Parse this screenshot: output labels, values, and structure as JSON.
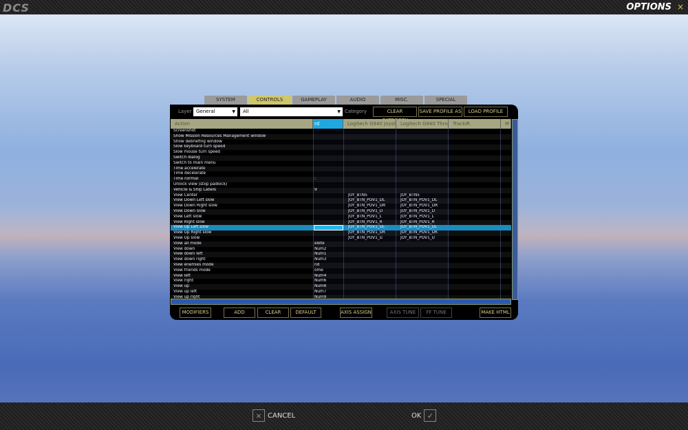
{
  "header": {
    "logo": "DCS",
    "title": "OPTIONS",
    "close": "×"
  },
  "tabs": [
    "SYSTEM",
    "CONTROLS",
    "GAMEPLAY",
    "AUDIO",
    "MISC.",
    "SPECIAL"
  ],
  "active_tab": "CONTROLS",
  "toolbar": {
    "layer_label": "Layer",
    "layer_value": "General",
    "category_filter_value": "All",
    "category_label": "Category",
    "clear_category": "CLEAR CATEGORY",
    "save_profile_as": "SAVE PROFILE AS",
    "load_profile": "LOAD PROFILE"
  },
  "columns": [
    "Action",
    "rd",
    "Logitech G940 Joyst",
    "Logitech G940 Throt",
    "TrackIR",
    "M"
  ],
  "rows": [
    {
      "action": "Screenshot",
      "kb": "",
      "joy": "",
      "thr": ""
    },
    {
      "action": "Show Mission Resources Management window",
      "kb": "",
      "joy": "",
      "thr": ""
    },
    {
      "action": "Show debriefing window",
      "kb": "",
      "joy": "",
      "thr": ""
    },
    {
      "action": "Slow keyboard turn speed",
      "kb": "",
      "joy": "",
      "thr": ""
    },
    {
      "action": "Slow mouse turn speed",
      "kb": "",
      "joy": "",
      "thr": ""
    },
    {
      "action": "Switch dialog",
      "kb": "",
      "joy": "",
      "thr": ""
    },
    {
      "action": "Switch to main menu",
      "kb": "",
      "joy": "",
      "thr": ""
    },
    {
      "action": "Time accelerate",
      "kb": "",
      "joy": "",
      "thr": ""
    },
    {
      "action": "Time decelerate",
      "kb": "",
      "joy": "",
      "thr": ""
    },
    {
      "action": "Time normal",
      "kb": ":",
      "joy": "",
      "thr": ""
    },
    {
      "action": "Unlock view (stop padlock)",
      "kb": "",
      "joy": "",
      "thr": ""
    },
    {
      "action": "Vehicle & Ship Labels",
      "kb": "9",
      "joy": "",
      "thr": ""
    },
    {
      "action": "View Center",
      "kb": "",
      "joy": "JOY_BTN5",
      "thr": "JOY_BTN5"
    },
    {
      "action": "View Down Left slow",
      "kb": "",
      "joy": "JOY_BTN_POV1_DL",
      "thr": "JOY_BTN_POV1_DL"
    },
    {
      "action": "View Down Right slow",
      "kb": "",
      "joy": "JOY_BTN_POV1_DR",
      "thr": "JOY_BTN_POV1_DR"
    },
    {
      "action": "View Down slow",
      "kb": "",
      "joy": "JOY_BTN_POV1_D",
      "thr": "JOY_BTN_POV1_D"
    },
    {
      "action": "View Left slow",
      "kb": "",
      "joy": "JOY_BTN_POV1_L",
      "thr": "JOY_BTN_POV1_L"
    },
    {
      "action": "View Right slow",
      "kb": "",
      "joy": "JOY_BTN_POV1_R",
      "thr": "JOY_BTN_POV1_R"
    },
    {
      "action": "View Up Left slow",
      "kb": "",
      "joy": "JOY_BTN_POV1_UL",
      "thr": "JOY_BTN_POV1_UL",
      "selected": true
    },
    {
      "action": "View Up Right slow",
      "kb": "",
      "joy": "JOY_BTN_POV1_UR",
      "thr": "JOY_BTN_POV1_UR"
    },
    {
      "action": "View Up slow",
      "kb": "",
      "joy": "JOY_BTN_POV1_U",
      "thr": "JOY_BTN_POV1_U"
    },
    {
      "action": "View all mode",
      "kb": "elete",
      "joy": "",
      "thr": ""
    },
    {
      "action": "View down",
      "kb": "Num2",
      "joy": "",
      "thr": ""
    },
    {
      "action": "View down left",
      "kb": "Num1",
      "joy": "",
      "thr": ""
    },
    {
      "action": "View down right",
      "kb": "Num3",
      "joy": "",
      "thr": ""
    },
    {
      "action": "View enemies mode",
      "kb": "nd",
      "joy": "",
      "thr": ""
    },
    {
      "action": "View friends mode",
      "kb": "ome",
      "joy": "",
      "thr": ""
    },
    {
      "action": "View left",
      "kb": "Num4",
      "joy": "",
      "thr": ""
    },
    {
      "action": "View right",
      "kb": "Num6",
      "joy": "",
      "thr": ""
    },
    {
      "action": "View up",
      "kb": "Num8",
      "joy": "",
      "thr": ""
    },
    {
      "action": "View up left",
      "kb": "Num7",
      "joy": "",
      "thr": ""
    },
    {
      "action": "View up right",
      "kb": "Num9",
      "joy": "",
      "thr": ""
    }
  ],
  "buttons": {
    "modifiers": "MODIFIERS",
    "add": "ADD",
    "clear": "CLEAR",
    "default": "DEFAULT",
    "axis_assign": "AXIS ASSIGN",
    "axis_tune": "AXIS TUNE",
    "ff_tune": "FF TUNE",
    "make_html": "MAKE HTML"
  },
  "footer": {
    "cancel": "CANCEL",
    "cancel_icon": "×",
    "ok": "OK",
    "ok_icon": "✓"
  }
}
